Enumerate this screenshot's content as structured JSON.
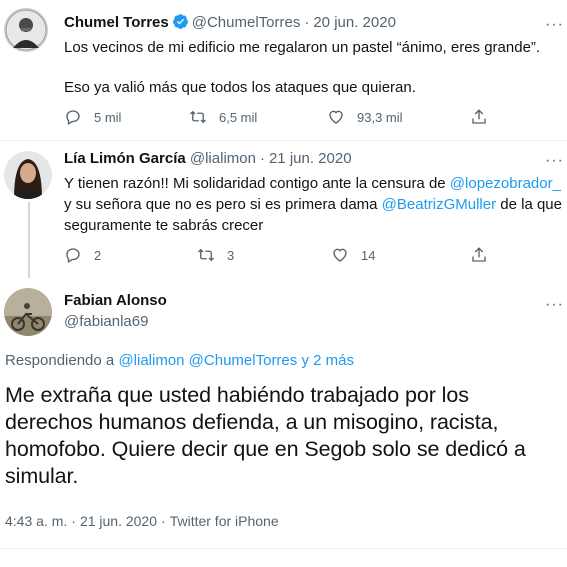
{
  "tweet1": {
    "name": "Chumel Torres",
    "handle": "@ChumelTorres",
    "date": "20 jun. 2020",
    "line1": "Los vecinos de mi edificio me regalaron un pastel “ánimo, eres grande”.",
    "line2": "Eso ya valió más que todos los ataques que quieran.",
    "replies": "5 mil",
    "retweets": "6,5 mil",
    "likes": "93,3 mil",
    "verified_color": "#1d9bf0"
  },
  "tweet2": {
    "name": "Lía Limón García",
    "handle": "@lialimon",
    "date": "21 jun. 2020",
    "text_a": "Y tienen razón!!  Mi solidaridad contigo ante la censura de ",
    "mention_a": "@lopezobrador_",
    "text_b": "y su señora que no es pero si es primera dama ",
    "mention_b": "@BeatrizGMuller",
    "text_c": " de la que",
    "text_d": "seguramente te sabrás crecer",
    "replies": "2",
    "retweets": "3",
    "likes": "14"
  },
  "tweet3": {
    "name": "Fabian Alonso",
    "handle": "@fabianla69",
    "replying_prefix": "Respondiendo a ",
    "replying_mentions": "@lialimon @ChumelTorres y 2 más",
    "text": "Me extraña que usted habiéndo trabajado por los derechos humanos defienda, a un misogino, racista, homofobo. Quiere decir que en Segob solo se dedicó a simular.",
    "time": "4:43 a. m.",
    "date": "21 jun. 2020",
    "client": "Twitter for iPhone"
  },
  "separator": "·",
  "more_glyph": "···",
  "colors": {
    "link": "#1d9bf0",
    "muted": "#536471",
    "text": "#0f1419"
  }
}
